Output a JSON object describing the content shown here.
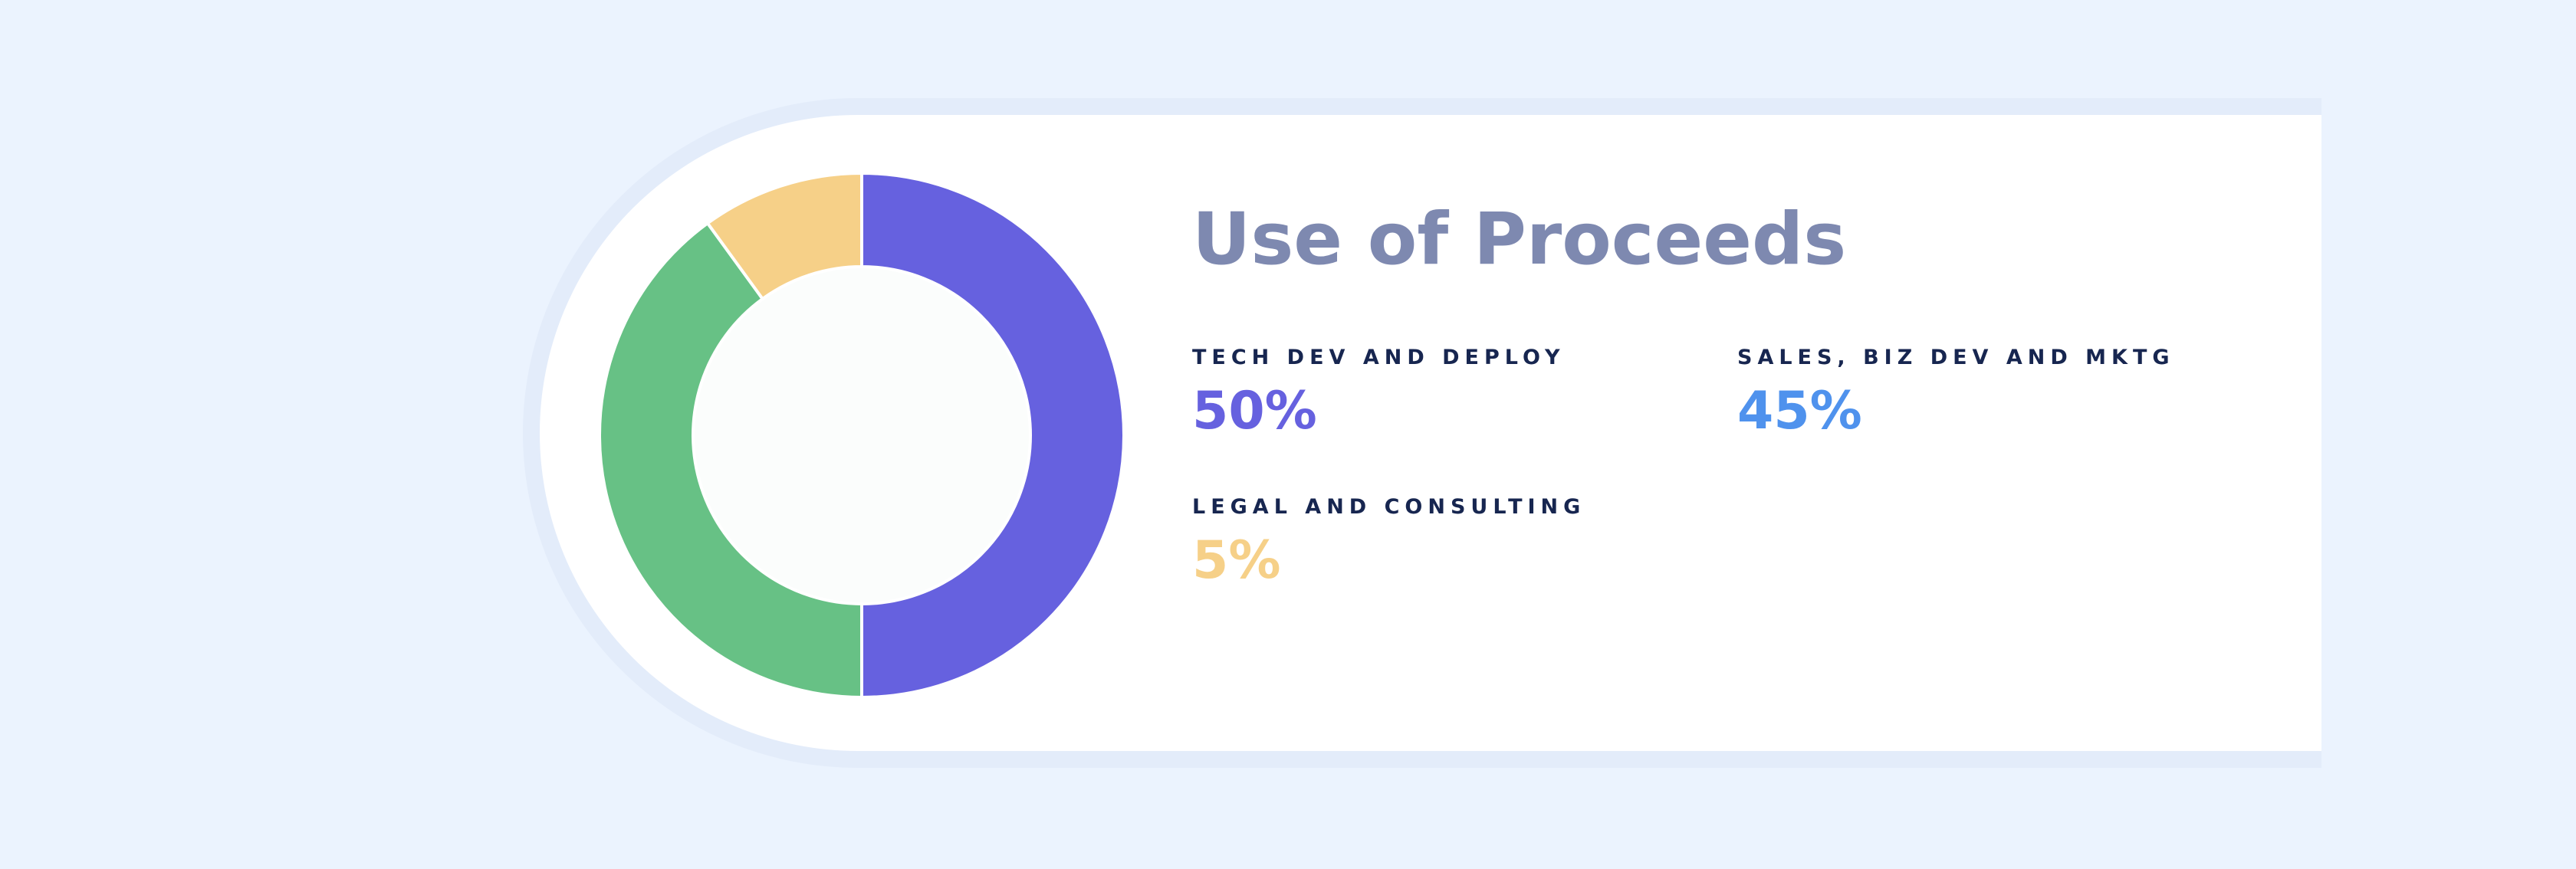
{
  "page": {
    "title": "Use of Proceeds"
  },
  "stats": [
    {
      "label": "TECH DEV AND DEPLOY",
      "value": "50%",
      "color": "#6661df"
    },
    {
      "label": "SALES, BIZ DEV AND MKTG",
      "value": "45%",
      "color": "#4f92ed"
    },
    {
      "label": "LEGAL AND CONSULTING",
      "value": "5%",
      "color": "#f6d088"
    }
  ],
  "chart_data": {
    "type": "pie",
    "donut": true,
    "slices": [
      {
        "value": 50,
        "color": "#6661df"
      },
      {
        "value": 40,
        "color": "#67c185"
      },
      {
        "value": 10,
        "color": "#f6d088"
      }
    ],
    "center_color": "#fbfdfc",
    "separator_color": "#ffffff"
  }
}
